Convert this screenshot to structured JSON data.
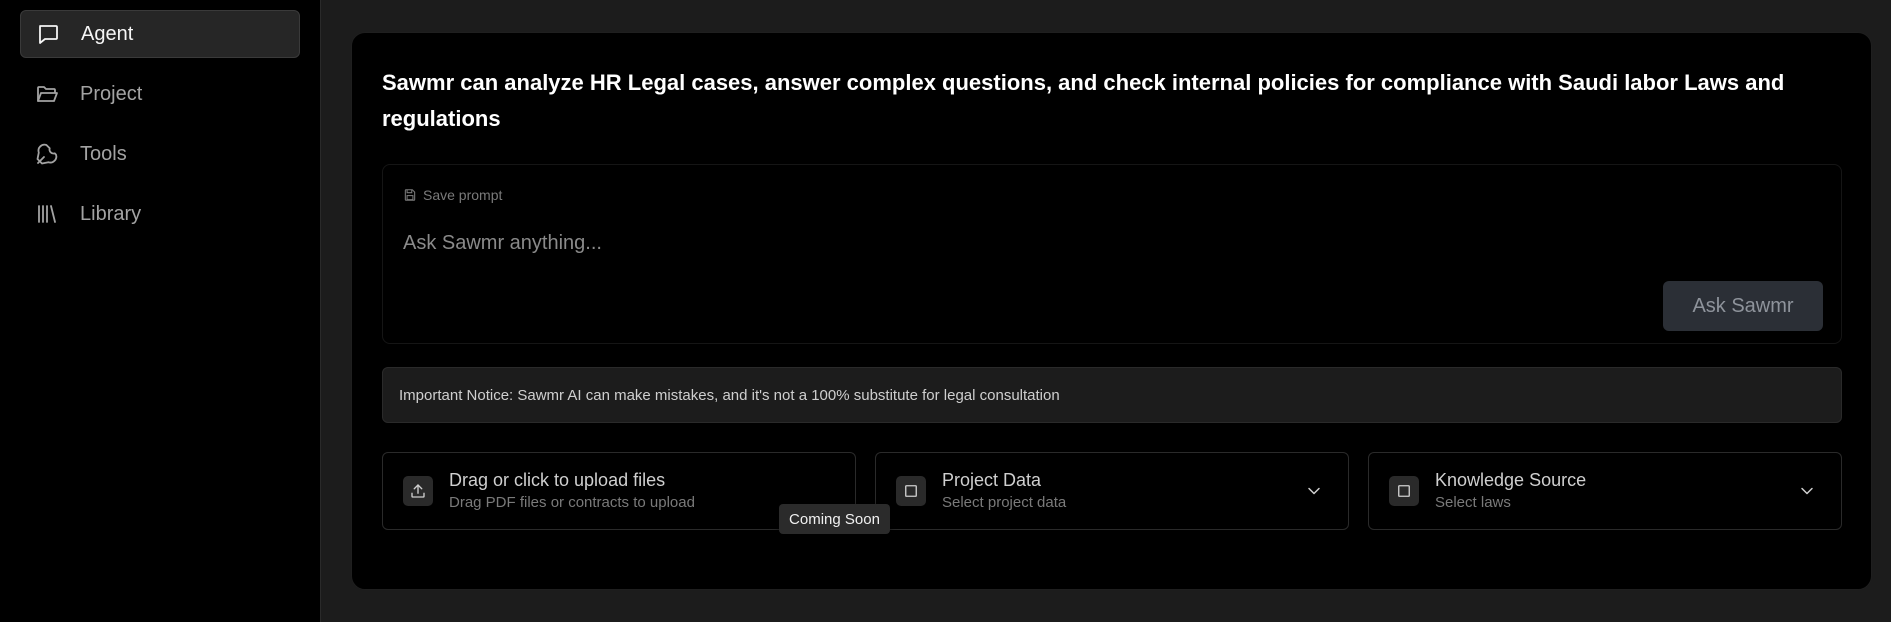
{
  "sidebar": {
    "items": [
      {
        "label": "Agent",
        "icon": "message-square-icon",
        "active": true
      },
      {
        "label": "Project",
        "icon": "folder-open-icon",
        "active": false
      },
      {
        "label": "Tools",
        "icon": "wrench-icon",
        "active": false
      },
      {
        "label": "Library",
        "icon": "library-icon",
        "active": false
      }
    ]
  },
  "main": {
    "headline": "Sawmr can analyze HR Legal cases, answer complex questions, and check internal policies for compliance with Saudi labor Laws and regulations",
    "prompt": {
      "save_label": "Save prompt",
      "placeholder": "Ask Sawmr anything...",
      "value": "",
      "submit_label": "Ask Sawmr"
    },
    "notice": "Important Notice: Sawmr AI can make mistakes, and it's not a 100% substitute for legal consultation",
    "options": {
      "upload": {
        "title": "Drag or click to upload files",
        "subtitle": "Drag PDF files or contracts to upload",
        "icon": "upload-icon"
      },
      "project": {
        "title": "Project Data",
        "subtitle": "Select project data",
        "icon": "checkbox-icon"
      },
      "knowledge": {
        "title": "Knowledge Source",
        "subtitle": "Select laws",
        "icon": "checkbox-icon"
      }
    },
    "tooltip": "Coming Soon"
  },
  "colors": {
    "background": "#000000",
    "content_bg": "#1c1c1c",
    "active_nav_bg": "#262626",
    "button_bg": "#2b2f36"
  }
}
